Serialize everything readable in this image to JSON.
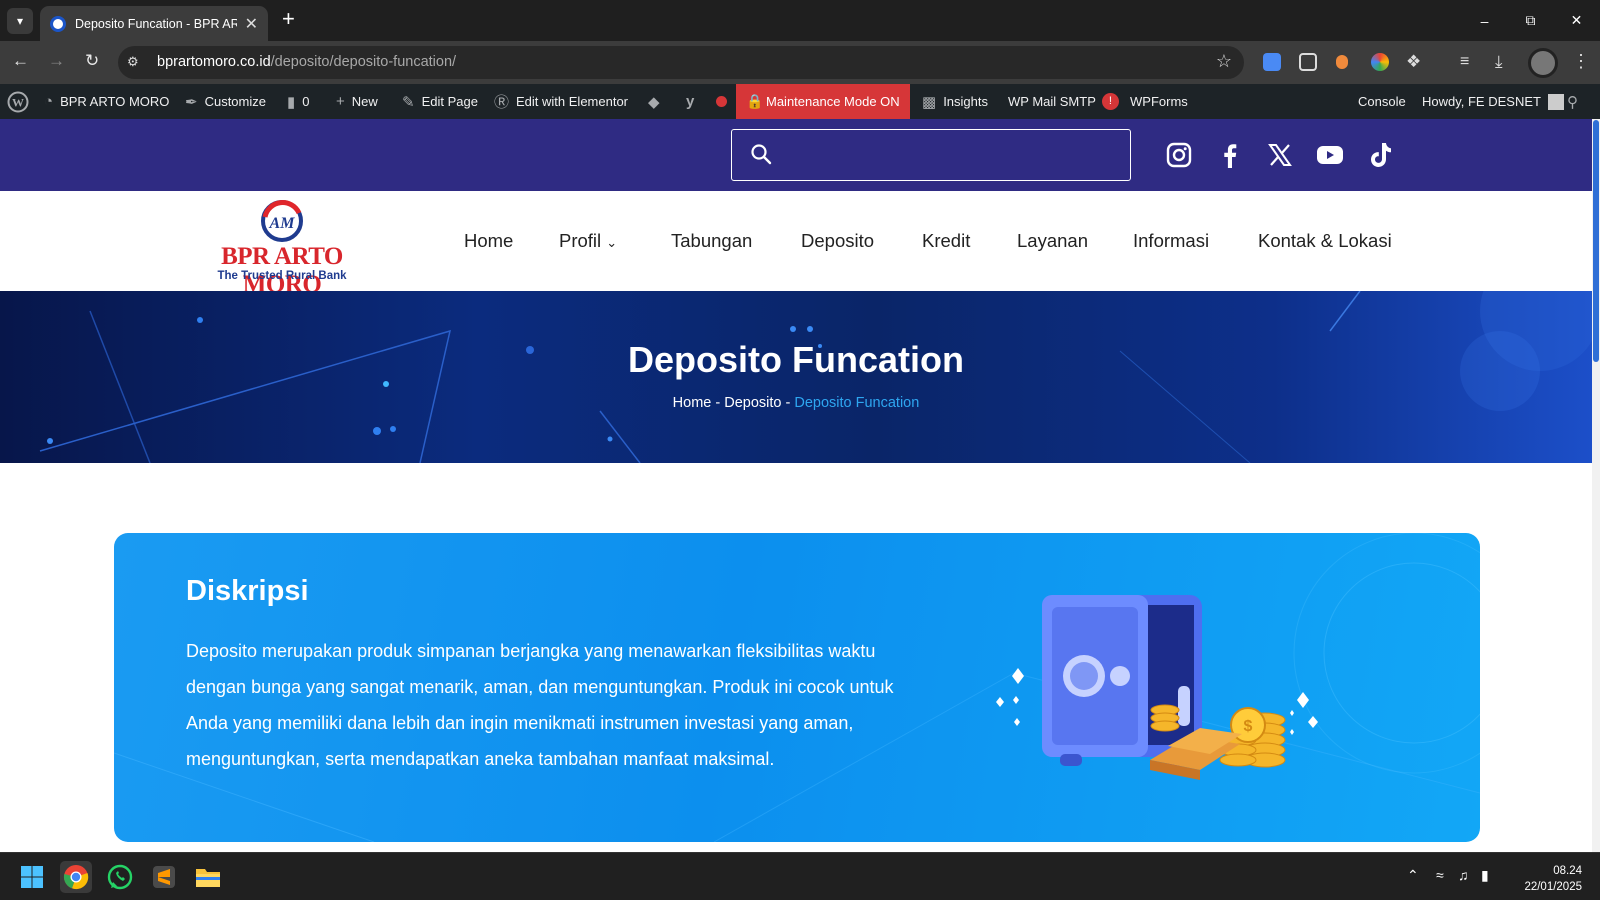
{
  "browser": {
    "tab_title": "Deposito Funcation - BPR ARTO MORO",
    "url_host": "bprartomoro.co.id",
    "url_path": "/deposito/deposito-funcation/"
  },
  "wp_admin_bar": {
    "site_name": "BPR ARTO MORO",
    "customize": "Customize",
    "comments_count": "0",
    "new": "New",
    "edit_page": "Edit Page",
    "edit_elementor": "Edit with Elementor",
    "maintenance": "Maintenance Mode ON",
    "insights": "Insights",
    "wp_mail_smtp": "WP Mail SMTP",
    "smtp_badge": "!",
    "wpforms": "WPForms",
    "console": "Console",
    "howdy": "Howdy, FE DESNET"
  },
  "site": {
    "logo_name": "BPR ARTO MORO",
    "logo_tagline": "The Trusted Rural Bank",
    "social_icons": [
      "instagram-icon",
      "facebook-icon",
      "x-icon",
      "youtube-icon",
      "tiktok-icon"
    ],
    "nav": [
      "Home",
      "Profil",
      "Tabungan",
      "Deposito",
      "Kredit",
      "Layanan",
      "Informasi",
      "Kontak & Lokasi"
    ]
  },
  "hero": {
    "title": "Deposito Funcation",
    "crumb_home": "Home",
    "crumb_sep1": " - ",
    "crumb_parent": "Deposito",
    "crumb_sep2": " - ",
    "crumb_current": "Deposito Funcation"
  },
  "description": {
    "heading": "Diskripsi",
    "body": "Deposito merupakan produk simpanan berjangka yang menawarkan fleksibilitas waktu dengan bunga yang sangat menarik, aman, dan menguntungkan. Produk ini cocok untuk Anda yang memiliki dana lebih dan ingin menikmati instrumen investasi yang aman, menguntungkan, serta mendapatkan aneka tambahan manfaat maksimal."
  },
  "taskbar": {
    "time": "08.24",
    "date": "22/01/2025"
  },
  "colors": {
    "brand_purple": "#2f2b83",
    "hero_dark": "#07164a",
    "card_blue": "#1a9bf2",
    "crumb_active": "#2ea6f0",
    "maintenance_red": "#d63638"
  }
}
